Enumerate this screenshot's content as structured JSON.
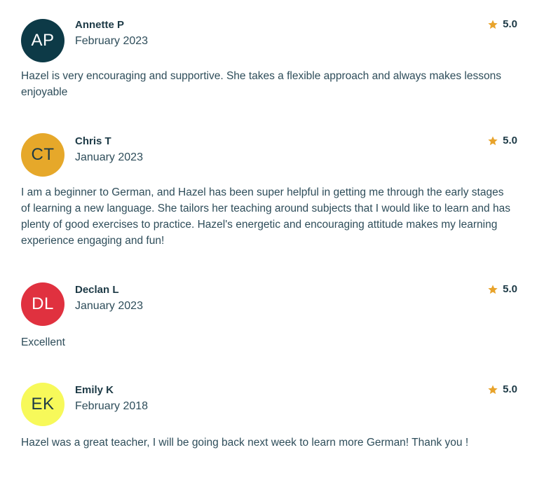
{
  "reviews": [
    {
      "initials": "AP",
      "avatar_bg": "#0d3a47",
      "avatar_fg": "#ffffff",
      "name": "Annette P",
      "date": "February 2023",
      "rating": "5.0",
      "text": "Hazel is very encouraging and supportive. She takes a flexible approach and always makes lessons enjoyable"
    },
    {
      "initials": "CT",
      "avatar_bg": "#e6a82a",
      "avatar_fg": "#1d3a46",
      "name": "Chris T",
      "date": "January 2023",
      "rating": "5.0",
      "text": "I am a beginner to German, and Hazel has been super helpful in getting me through the early stages of learning a new language. She tailors her teaching around subjects that I would like to learn and has plenty of good exercises to practice. Hazel's energetic and encouraging attitude makes my learning experience engaging and fun!"
    },
    {
      "initials": "DL",
      "avatar_bg": "#e0313f",
      "avatar_fg": "#ffffff",
      "name": "Declan L",
      "date": "January 2023",
      "rating": "5.0",
      "text": "Excellent"
    },
    {
      "initials": "EK",
      "avatar_bg": "#f7f95a",
      "avatar_fg": "#1d3a46",
      "name": "Emily K",
      "date": "February 2018",
      "rating": "5.0",
      "text": "Hazel was a great teacher, I will be going back next week to learn more German! Thank you !"
    }
  ],
  "star_color": "#e8a32b"
}
